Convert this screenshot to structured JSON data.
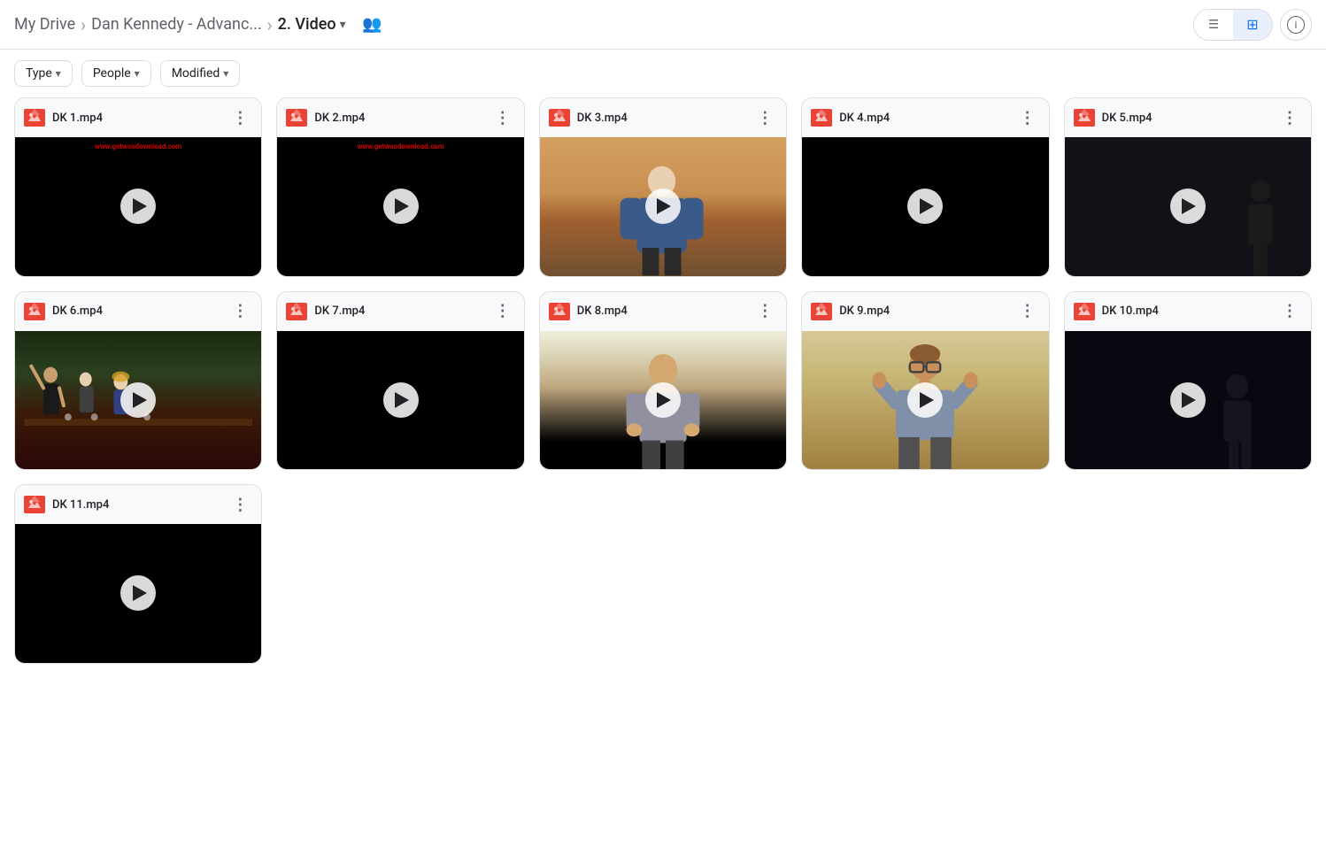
{
  "header": {
    "breadcrumb": {
      "root": "My Drive",
      "separator1": ">",
      "folder": "Dan Kennedy - Advanc...",
      "separator2": ">",
      "current": "2. Video",
      "dropdown_icon": "▾"
    },
    "shared_people_icon": "👥",
    "view_list_icon": "☰",
    "view_grid_icon": "⊞",
    "info_icon": "ℹ"
  },
  "filters": [
    {
      "label": "Type",
      "arrow": "▾"
    },
    {
      "label": "People",
      "arrow": "▾"
    },
    {
      "label": "Modified",
      "arrow": "▾"
    }
  ],
  "videos": [
    {
      "id": "dk1",
      "title": "DK 1.mp4",
      "watermark": "www.getwsodownload.com",
      "thumbnail_class": "thumb-dk1"
    },
    {
      "id": "dk2",
      "title": "DK 2.mp4",
      "watermark": "www.getwsodownload.com",
      "thumbnail_class": "thumb-dk2"
    },
    {
      "id": "dk3",
      "title": "DK 3.mp4",
      "watermark": null,
      "thumbnail_class": "thumb-dk3"
    },
    {
      "id": "dk4",
      "title": "DK 4.mp4",
      "watermark": null,
      "thumbnail_class": "thumb-dk4"
    },
    {
      "id": "dk5",
      "title": "DK 5.mp4",
      "watermark": null,
      "thumbnail_class": "thumb-dk5"
    },
    {
      "id": "dk6",
      "title": "DK 6.mp4",
      "watermark": null,
      "thumbnail_class": "thumb-dk6"
    },
    {
      "id": "dk7",
      "title": "DK 7.mp4",
      "watermark": null,
      "thumbnail_class": "thumb-dk7"
    },
    {
      "id": "dk8",
      "title": "DK 8.mp4",
      "watermark": null,
      "thumbnail_class": "thumb-dk8"
    },
    {
      "id": "dk9",
      "title": "DK 9.mp4",
      "watermark": null,
      "thumbnail_class": "thumb-dk9"
    },
    {
      "id": "dk10",
      "title": "DK 10.mp4",
      "watermark": null,
      "thumbnail_class": "thumb-dk10"
    },
    {
      "id": "dk11",
      "title": "DK 11.mp4",
      "watermark": null,
      "thumbnail_class": "thumb-dk11"
    }
  ],
  "icons": {
    "list_view": "☰",
    "grid_view": "⊞",
    "check": "✓",
    "info": "ⓘ",
    "people": "👥",
    "more_vert": "⋮"
  }
}
